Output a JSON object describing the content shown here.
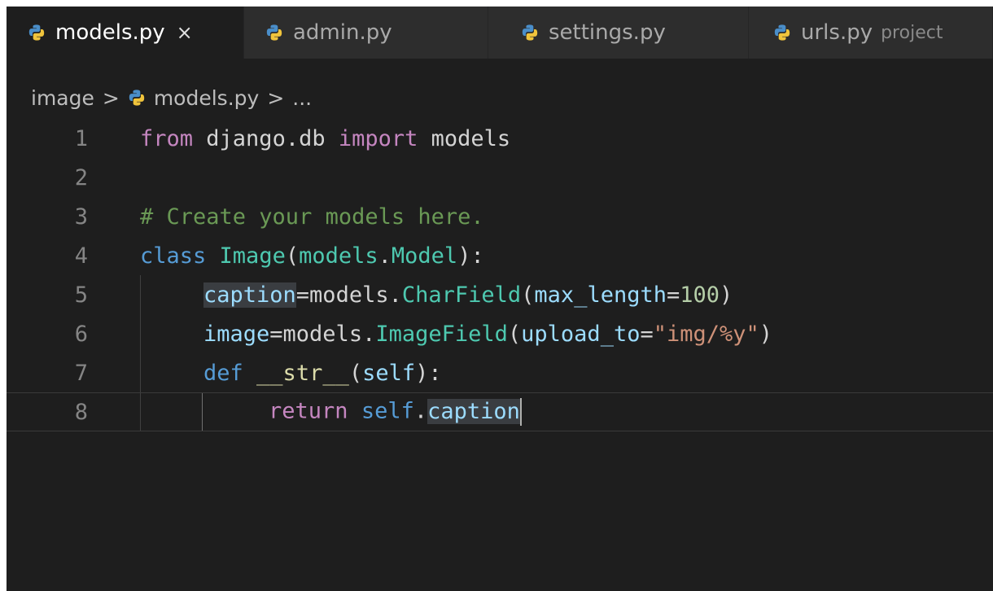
{
  "tabs": [
    {
      "label": "models.py",
      "close": "×",
      "active": true
    },
    {
      "label": "admin.py",
      "active": false
    },
    {
      "label": "settings.py",
      "active": false
    },
    {
      "label": "urls.py",
      "description": "project",
      "active": false
    }
  ],
  "breadcrumb": {
    "folder": "image",
    "separator": ">",
    "file": "models.py",
    "ellipsis": "..."
  },
  "editor": {
    "line_numbers": [
      "1",
      "2",
      "3",
      "4",
      "5",
      "6",
      "7",
      "8"
    ],
    "line1": {
      "t1": "from",
      "t2": " django.db ",
      "t3": "import",
      "t4": " models"
    },
    "line3": {
      "t1": "# Create your models here."
    },
    "line4": {
      "t1": "class",
      "t2": " ",
      "t3": "Image",
      "t4": "(",
      "t5": "models",
      "t6": ".",
      "t7": "Model",
      "t8": "):"
    },
    "line5": {
      "t1": "caption",
      "t2": "=models.",
      "t3": "CharField",
      "t4": "(",
      "t5": "max_length",
      "t6": "=",
      "t7": "100",
      "t8": ")"
    },
    "line6": {
      "t1": "image",
      "t2": "=models.",
      "t3": "ImageField",
      "t4": "(",
      "t5": "upload_to",
      "t6": "=",
      "t7": "\"img/%y\"",
      "t8": ")"
    },
    "line7": {
      "t1": "def",
      "t2": " ",
      "t3": "__str__",
      "t4": "(",
      "t5": "self",
      "t6": "):"
    },
    "line8": {
      "t1": "return",
      "t2": " ",
      "t3": "self",
      "t4": ".",
      "t5": "caption"
    }
  },
  "colors": {
    "background": "#1e1e1e",
    "keyword_control": "#c586c0",
    "keyword_storage": "#569cd6",
    "class_name": "#4ec9b0",
    "variable": "#9cdcfe",
    "function": "#dcdcaa",
    "string": "#ce9178",
    "number": "#b5cea8",
    "comment": "#6a9955"
  },
  "icons": {
    "file_type": "python-icon",
    "tab_close": "close-icon"
  }
}
